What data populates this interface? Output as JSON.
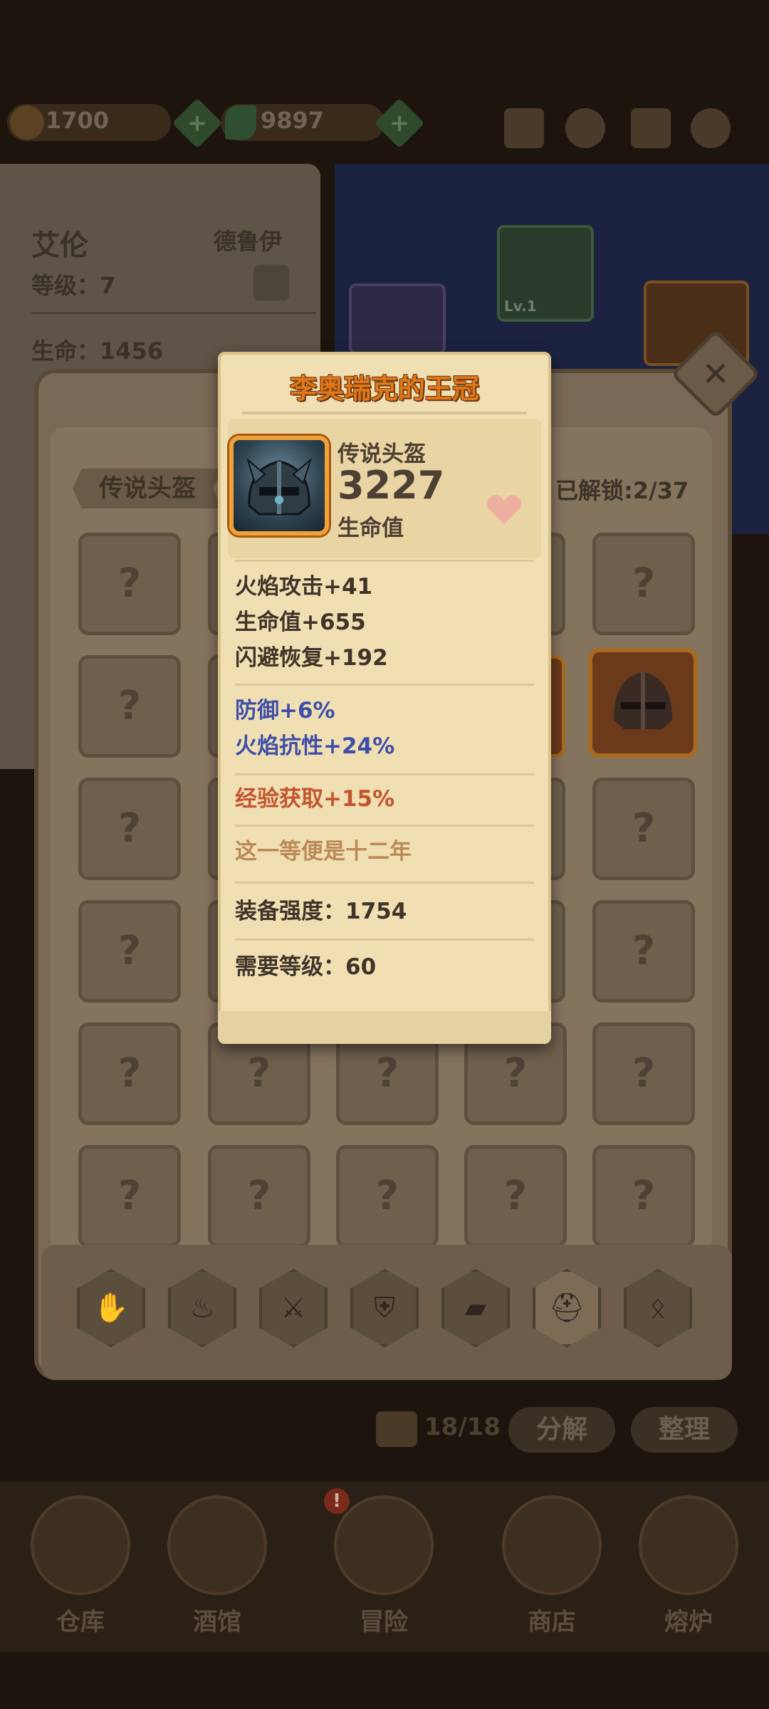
{
  "topbar": {
    "gold": "1700",
    "gems": "9897"
  },
  "hero": {
    "name": "艾伦",
    "class": "德鲁伊",
    "level_text": "等级：7",
    "hp_text": "生命：1456"
  },
  "stage": {
    "helmet_level": "Lv.1"
  },
  "inventory": {
    "category": "传说头盔",
    "unlocked": "已解锁:2/37",
    "locked_symbol": "?"
  },
  "type_bar": {
    "icons": [
      "glove-icon",
      "chicken-leg-icon",
      "sword-icon",
      "shield-icon",
      "book-icon",
      "helmet-icon",
      "amulet-icon"
    ]
  },
  "bag": {
    "count": "18/18",
    "decompose_label": "分解",
    "sort_label": "整理"
  },
  "bottom_nav": {
    "items": [
      {
        "label": "仓库"
      },
      {
        "label": "酒馆"
      },
      {
        "label": "冒险"
      },
      {
        "label": "商店"
      },
      {
        "label": "熔炉"
      }
    ],
    "alert": "!"
  },
  "item_card": {
    "title": "李奥瑞克的王冠",
    "type": "传说头盔",
    "main_value": "3227",
    "main_value_label": "生命值",
    "base_stats": [
      "火焰攻击+41",
      "生命值+655",
      "闪避恢复+192"
    ],
    "blue_stats": [
      "防御+6%",
      "火焰抗性+24%"
    ],
    "red_stat": "经验获取+15%",
    "flavor": "这一等便是十二年",
    "power": "装备强度：1754",
    "required_level": "需要等级：60"
  },
  "colors": {
    "title_orange": "#e2771a",
    "stat_dark": "#3f3428",
    "stat_blue": "#3e4fa8",
    "stat_red": "#c2552e",
    "flavor": "#b98a55",
    "frame_gold": "#f1a13a"
  }
}
